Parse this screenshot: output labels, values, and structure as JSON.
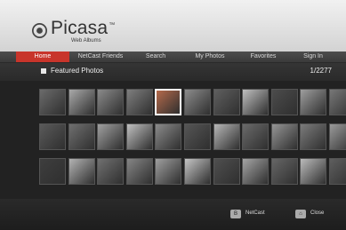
{
  "app": {
    "logo_text": "Picasa",
    "logo_tm": "™",
    "logo_sub": "Web Albums"
  },
  "nav": {
    "items": [
      {
        "label": "Home",
        "active": true
      },
      {
        "label": "NetCast Friends",
        "active": false
      },
      {
        "label": "Search",
        "active": false
      },
      {
        "label": "My Photos",
        "active": false
      },
      {
        "label": "Favorites",
        "active": false
      },
      {
        "label": "Sign In",
        "active": false
      }
    ]
  },
  "section": {
    "title": "Featured Photos",
    "count": "1/2277"
  },
  "grid": {
    "rows": 3,
    "cols": 11,
    "selected_index": 4,
    "thumb_colors": [
      "#6b6b6b",
      "#a9a9a9",
      "#8a8a8a",
      "#7e7e7e",
      "#b56a4b",
      "#8c8c8c",
      "#5f5f5f",
      "#bfbfbf",
      "#4c4c4c",
      "#9e9e9e",
      "#777777",
      "#5a5a5a",
      "#6f6f6f",
      "#a0a0a0",
      "#c0c0c0",
      "#8b8b8b",
      "#555555",
      "#b7b7b7",
      "#6a6a6a",
      "#959595",
      "#7b7b7b",
      "#9a9a9a",
      "#3e3e3e",
      "#b3b3b3",
      "#707070",
      "#858585",
      "#9f9f9f",
      "#c5c5c5",
      "#4f4f4f",
      "#a5a5a5",
      "#666666",
      "#bbbbbb",
      "#5e5e5e"
    ]
  },
  "footer": {
    "keys": [
      {
        "key": "B",
        "label": "NetCast"
      },
      {
        "key": "⌂",
        "label": "Close"
      }
    ]
  }
}
